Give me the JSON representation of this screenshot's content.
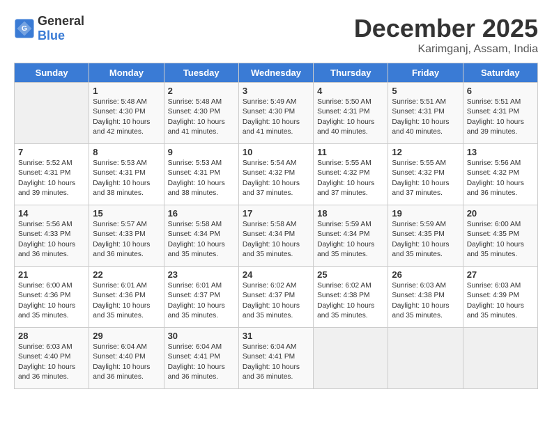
{
  "header": {
    "logo_general": "General",
    "logo_blue": "Blue",
    "month": "December 2025",
    "location": "Karimganj, Assam, India"
  },
  "days_of_week": [
    "Sunday",
    "Monday",
    "Tuesday",
    "Wednesday",
    "Thursday",
    "Friday",
    "Saturday"
  ],
  "weeks": [
    [
      {
        "day": "",
        "sunrise": "",
        "sunset": "",
        "daylight": ""
      },
      {
        "day": "1",
        "sunrise": "Sunrise: 5:48 AM",
        "sunset": "Sunset: 4:30 PM",
        "daylight": "Daylight: 10 hours and 42 minutes."
      },
      {
        "day": "2",
        "sunrise": "Sunrise: 5:48 AM",
        "sunset": "Sunset: 4:30 PM",
        "daylight": "Daylight: 10 hours and 41 minutes."
      },
      {
        "day": "3",
        "sunrise": "Sunrise: 5:49 AM",
        "sunset": "Sunset: 4:30 PM",
        "daylight": "Daylight: 10 hours and 41 minutes."
      },
      {
        "day": "4",
        "sunrise": "Sunrise: 5:50 AM",
        "sunset": "Sunset: 4:31 PM",
        "daylight": "Daylight: 10 hours and 40 minutes."
      },
      {
        "day": "5",
        "sunrise": "Sunrise: 5:51 AM",
        "sunset": "Sunset: 4:31 PM",
        "daylight": "Daylight: 10 hours and 40 minutes."
      },
      {
        "day": "6",
        "sunrise": "Sunrise: 5:51 AM",
        "sunset": "Sunset: 4:31 PM",
        "daylight": "Daylight: 10 hours and 39 minutes."
      }
    ],
    [
      {
        "day": "7",
        "sunrise": "Sunrise: 5:52 AM",
        "sunset": "Sunset: 4:31 PM",
        "daylight": "Daylight: 10 hours and 39 minutes."
      },
      {
        "day": "8",
        "sunrise": "Sunrise: 5:53 AM",
        "sunset": "Sunset: 4:31 PM",
        "daylight": "Daylight: 10 hours and 38 minutes."
      },
      {
        "day": "9",
        "sunrise": "Sunrise: 5:53 AM",
        "sunset": "Sunset: 4:31 PM",
        "daylight": "Daylight: 10 hours and 38 minutes."
      },
      {
        "day": "10",
        "sunrise": "Sunrise: 5:54 AM",
        "sunset": "Sunset: 4:32 PM",
        "daylight": "Daylight: 10 hours and 37 minutes."
      },
      {
        "day": "11",
        "sunrise": "Sunrise: 5:55 AM",
        "sunset": "Sunset: 4:32 PM",
        "daylight": "Daylight: 10 hours and 37 minutes."
      },
      {
        "day": "12",
        "sunrise": "Sunrise: 5:55 AM",
        "sunset": "Sunset: 4:32 PM",
        "daylight": "Daylight: 10 hours and 37 minutes."
      },
      {
        "day": "13",
        "sunrise": "Sunrise: 5:56 AM",
        "sunset": "Sunset: 4:32 PM",
        "daylight": "Daylight: 10 hours and 36 minutes."
      }
    ],
    [
      {
        "day": "14",
        "sunrise": "Sunrise: 5:56 AM",
        "sunset": "Sunset: 4:33 PM",
        "daylight": "Daylight: 10 hours and 36 minutes."
      },
      {
        "day": "15",
        "sunrise": "Sunrise: 5:57 AM",
        "sunset": "Sunset: 4:33 PM",
        "daylight": "Daylight: 10 hours and 36 minutes."
      },
      {
        "day": "16",
        "sunrise": "Sunrise: 5:58 AM",
        "sunset": "Sunset: 4:34 PM",
        "daylight": "Daylight: 10 hours and 35 minutes."
      },
      {
        "day": "17",
        "sunrise": "Sunrise: 5:58 AM",
        "sunset": "Sunset: 4:34 PM",
        "daylight": "Daylight: 10 hours and 35 minutes."
      },
      {
        "day": "18",
        "sunrise": "Sunrise: 5:59 AM",
        "sunset": "Sunset: 4:34 PM",
        "daylight": "Daylight: 10 hours and 35 minutes."
      },
      {
        "day": "19",
        "sunrise": "Sunrise: 5:59 AM",
        "sunset": "Sunset: 4:35 PM",
        "daylight": "Daylight: 10 hours and 35 minutes."
      },
      {
        "day": "20",
        "sunrise": "Sunrise: 6:00 AM",
        "sunset": "Sunset: 4:35 PM",
        "daylight": "Daylight: 10 hours and 35 minutes."
      }
    ],
    [
      {
        "day": "21",
        "sunrise": "Sunrise: 6:00 AM",
        "sunset": "Sunset: 4:36 PM",
        "daylight": "Daylight: 10 hours and 35 minutes."
      },
      {
        "day": "22",
        "sunrise": "Sunrise: 6:01 AM",
        "sunset": "Sunset: 4:36 PM",
        "daylight": "Daylight: 10 hours and 35 minutes."
      },
      {
        "day": "23",
        "sunrise": "Sunrise: 6:01 AM",
        "sunset": "Sunset: 4:37 PM",
        "daylight": "Daylight: 10 hours and 35 minutes."
      },
      {
        "day": "24",
        "sunrise": "Sunrise: 6:02 AM",
        "sunset": "Sunset: 4:37 PM",
        "daylight": "Daylight: 10 hours and 35 minutes."
      },
      {
        "day": "25",
        "sunrise": "Sunrise: 6:02 AM",
        "sunset": "Sunset: 4:38 PM",
        "daylight": "Daylight: 10 hours and 35 minutes."
      },
      {
        "day": "26",
        "sunrise": "Sunrise: 6:03 AM",
        "sunset": "Sunset: 4:38 PM",
        "daylight": "Daylight: 10 hours and 35 minutes."
      },
      {
        "day": "27",
        "sunrise": "Sunrise: 6:03 AM",
        "sunset": "Sunset: 4:39 PM",
        "daylight": "Daylight: 10 hours and 35 minutes."
      }
    ],
    [
      {
        "day": "28",
        "sunrise": "Sunrise: 6:03 AM",
        "sunset": "Sunset: 4:40 PM",
        "daylight": "Daylight: 10 hours and 36 minutes."
      },
      {
        "day": "29",
        "sunrise": "Sunrise: 6:04 AM",
        "sunset": "Sunset: 4:40 PM",
        "daylight": "Daylight: 10 hours and 36 minutes."
      },
      {
        "day": "30",
        "sunrise": "Sunrise: 6:04 AM",
        "sunset": "Sunset: 4:41 PM",
        "daylight": "Daylight: 10 hours and 36 minutes."
      },
      {
        "day": "31",
        "sunrise": "Sunrise: 6:04 AM",
        "sunset": "Sunset: 4:41 PM",
        "daylight": "Daylight: 10 hours and 36 minutes."
      },
      {
        "day": "",
        "sunrise": "",
        "sunset": "",
        "daylight": ""
      },
      {
        "day": "",
        "sunrise": "",
        "sunset": "",
        "daylight": ""
      },
      {
        "day": "",
        "sunrise": "",
        "sunset": "",
        "daylight": ""
      }
    ]
  ]
}
